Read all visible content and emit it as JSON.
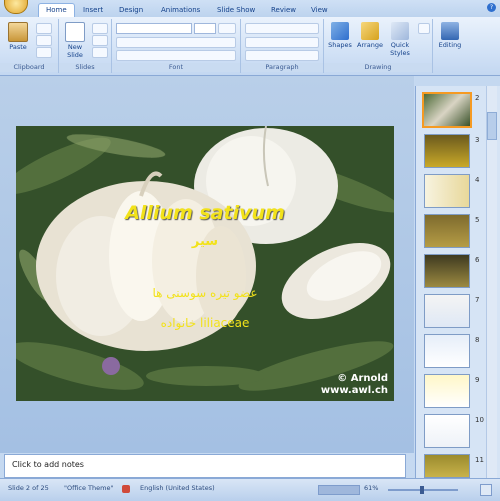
{
  "ribbon_tabs": [
    "Home",
    "Insert",
    "Design",
    "Animations",
    "Slide Show",
    "Review",
    "View"
  ],
  "active_tab": "Home",
  "groups": {
    "clipboard": {
      "label": "Clipboard",
      "paste": "Paste"
    },
    "slides": {
      "label": "Slides",
      "new_slide": "New Slide"
    },
    "font": {
      "label": "Font"
    },
    "paragraph": {
      "label": "Paragraph"
    },
    "drawing": {
      "label": "Drawing",
      "shapes": "Shapes",
      "arrange": "Arrange",
      "quick_styles": "Quick Styles"
    },
    "editing": {
      "label": "Editing"
    }
  },
  "slide": {
    "title": "Allium sativum",
    "subtitle1": "سیر",
    "subtitle2": "عضو تیره سوسنی ها",
    "subtitle3": "خانواده liliaceae",
    "credit_line1": "© Arnold",
    "credit_line2": "www.awl.ch"
  },
  "notes_placeholder": "Click to add notes",
  "thumbnails": [
    {
      "num": "2"
    },
    {
      "num": "3"
    },
    {
      "num": "4"
    },
    {
      "num": "5"
    },
    {
      "num": "6"
    },
    {
      "num": "7"
    },
    {
      "num": "8"
    },
    {
      "num": "9"
    },
    {
      "num": "10"
    },
    {
      "num": "11"
    }
  ],
  "status": {
    "slide_info": "Slide 2 of 25",
    "theme": "\"Office Theme\"",
    "language": "English (United States)",
    "zoom": "61%"
  },
  "colors": {
    "accent": "#f59a23",
    "slide_text": "#f2e21a"
  }
}
